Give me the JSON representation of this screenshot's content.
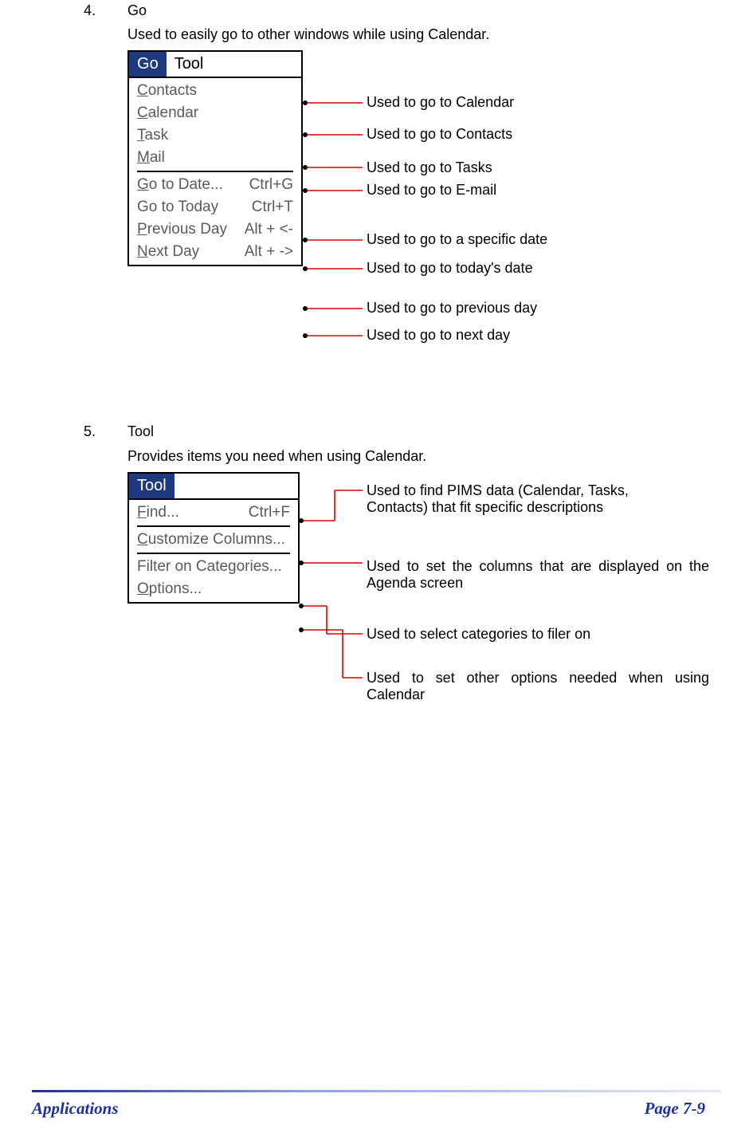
{
  "section4": {
    "num": "4.",
    "title": "Go",
    "desc": "Used to easily go to other windows while using Calendar."
  },
  "goMenu": {
    "bar": {
      "go": "Go",
      "tool": "Tool",
      "go_ul": "G",
      "tool_ul": "T"
    },
    "items": [
      {
        "label": "Contacts",
        "ul": "C",
        "rest": "ontacts",
        "shortcut": "",
        "desc": "Used to go to Calendar"
      },
      {
        "label": "Calendar",
        "ul": "C",
        "rest": "alendar",
        "shortcut": "",
        "desc": "Used to go to Contacts"
      },
      {
        "label": "Task",
        "ul": "T",
        "rest": "ask",
        "shortcut": "",
        "desc": "Used to go to Tasks"
      },
      {
        "label": "Mail",
        "ul": "M",
        "rest": "ail",
        "shortcut": "",
        "desc": "Used to go to E-mail"
      },
      {
        "label": "Go to Date...",
        "ul": "G",
        "rest": "o to Date...",
        "shortcut": "Ctrl+G",
        "desc": "Used to go to a specific date"
      },
      {
        "label": "Go to Today",
        "ul": "",
        "rest": "Go to Today",
        "shortcut": "Ctrl+T",
        "desc": "Used to go to today's date"
      },
      {
        "label": "Previous Day",
        "ul": "P",
        "rest": "revious Day",
        "shortcut": "Alt + <-",
        "desc": "Used to go to previous day"
      },
      {
        "label": "Next Day",
        "ul": "N",
        "rest": "ext Day",
        "shortcut": "Alt + ->",
        "desc": "Used to go to next day"
      }
    ]
  },
  "section5": {
    "num": "5.",
    "title": "Tool",
    "desc": "Provides items you need when using Calendar."
  },
  "toolMenu": {
    "bar": {
      "tool": "Tool",
      "tool_ul": "T"
    },
    "items": [
      {
        "label": "Find...",
        "ul": "F",
        "rest": "ind...",
        "shortcut": "Ctrl+F",
        "desc": "Used to find PIMS data (Calendar, Tasks, Contacts) that fit specific descriptions"
      },
      {
        "label": "Customize Columns...",
        "ul": "C",
        "rest": "ustomize Columns...",
        "shortcut": "",
        "desc": "Used to set the columns that are displayed on the Agenda screen"
      },
      {
        "label": "Filter on Categories...",
        "ul": "",
        "rest": "Filter on Categories...",
        "shortcut": "",
        "desc": "Used to select categories to filer on"
      },
      {
        "label": "Options...",
        "ul": "O",
        "rest": "ptions...",
        "shortcut": "",
        "desc": "Used to set other options needed when using Calendar"
      }
    ]
  },
  "footer": {
    "left": "Applications",
    "right": "Page 7-9"
  }
}
